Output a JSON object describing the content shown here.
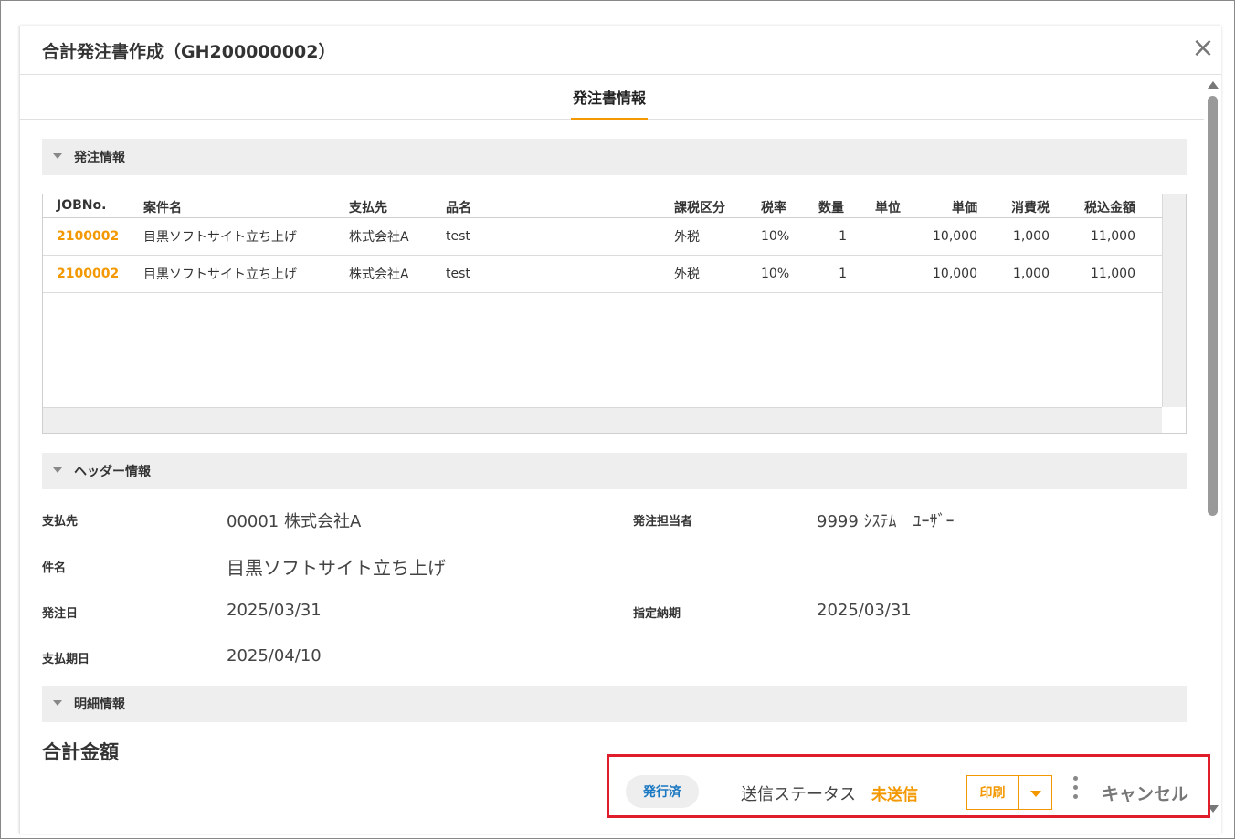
{
  "dialog": {
    "title": "合計発注書作成（GH200000002）",
    "close_symbol": "×"
  },
  "tabs": [
    {
      "label": "発注書情報",
      "active": true
    }
  ],
  "sections": {
    "order_info": "発注情報",
    "header_info": "ヘッダー情報",
    "detail_info": "明細情報"
  },
  "grid": {
    "columns": [
      "JOBNo.",
      "案件名",
      "支払先",
      "品名",
      "課税区分",
      "税率",
      "数量",
      "単位",
      "単価",
      "消費税",
      "税込金額"
    ],
    "rows": [
      {
        "job_no": "2100002",
        "project": "目黒ソフトサイト立ち上げ",
        "payee": "株式会社A",
        "item": "test",
        "tax_type": "外税",
        "tax_rate": "10%",
        "qty": "1",
        "unit": "",
        "unit_price": "10,000",
        "tax": "1,000",
        "total": "11,000"
      },
      {
        "job_no": "2100002",
        "project": "目黒ソフトサイト立ち上げ",
        "payee": "株式会社A",
        "item": "test",
        "tax_type": "外税",
        "tax_rate": "10%",
        "qty": "1",
        "unit": "",
        "unit_price": "10,000",
        "tax": "1,000",
        "total": "11,000"
      }
    ]
  },
  "header_fields": {
    "payee_label": "支払先",
    "payee_value": "00001 株式会社A",
    "orderer_label": "発注担当者",
    "orderer_value": "9999 ｼｽﾃﾑ　ﾕｰｻﾞｰ",
    "subject_label": "件名",
    "subject_value": "目黒ソフトサイト立ち上げ",
    "order_date_label": "発注日",
    "order_date_value": "2025/03/31",
    "delivery_label": "指定納期",
    "delivery_value": "2025/03/31",
    "pay_date_label": "支払期日",
    "pay_date_value": "2025/04/10"
  },
  "total": {
    "title": "合計金額"
  },
  "footer": {
    "badge": "発行済",
    "status_label": "送信ステータス",
    "status_value": "未送信",
    "print_label": "印刷",
    "cancel_label": "キャンセル"
  },
  "colors": {
    "accent": "#f39800",
    "badge_text": "#1a78c2",
    "highlight_box": "#e01e2b"
  },
  "icons": {
    "close": "close-icon",
    "section_toggle": "caret-down-icon",
    "print_dropdown": "chevron-down-icon",
    "more": "kebab-menu-icon"
  }
}
